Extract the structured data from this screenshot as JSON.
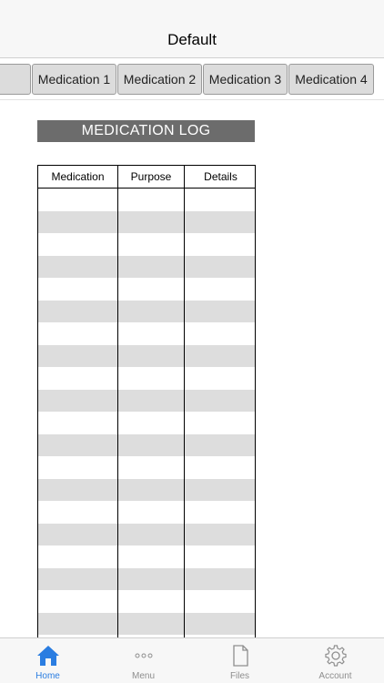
{
  "nav": {
    "title": "Default"
  },
  "tabs": {
    "partial_label": "",
    "items": [
      {
        "label": "Medication 1"
      },
      {
        "label": "Medication 2"
      },
      {
        "label": "Medication 3"
      },
      {
        "label": "Medication 4"
      }
    ]
  },
  "document": {
    "title": "MEDICATION LOG",
    "columns": [
      "Medication",
      "Purpose",
      "Details"
    ]
  },
  "tabbar": {
    "items": [
      {
        "label": "Home",
        "icon": "home-icon",
        "active": true
      },
      {
        "label": "Menu",
        "icon": "more-icon",
        "active": false
      },
      {
        "label": "Files",
        "icon": "file-icon",
        "active": false
      },
      {
        "label": "Account",
        "icon": "gear-icon",
        "active": false
      }
    ],
    "active_color": "#2a7de1",
    "inactive_color": "#8e8e8e"
  },
  "colors": {
    "header_bg": "#6c6c6c",
    "stripe": "#dddddd",
    "tab_bg": "#dcdcdc"
  }
}
